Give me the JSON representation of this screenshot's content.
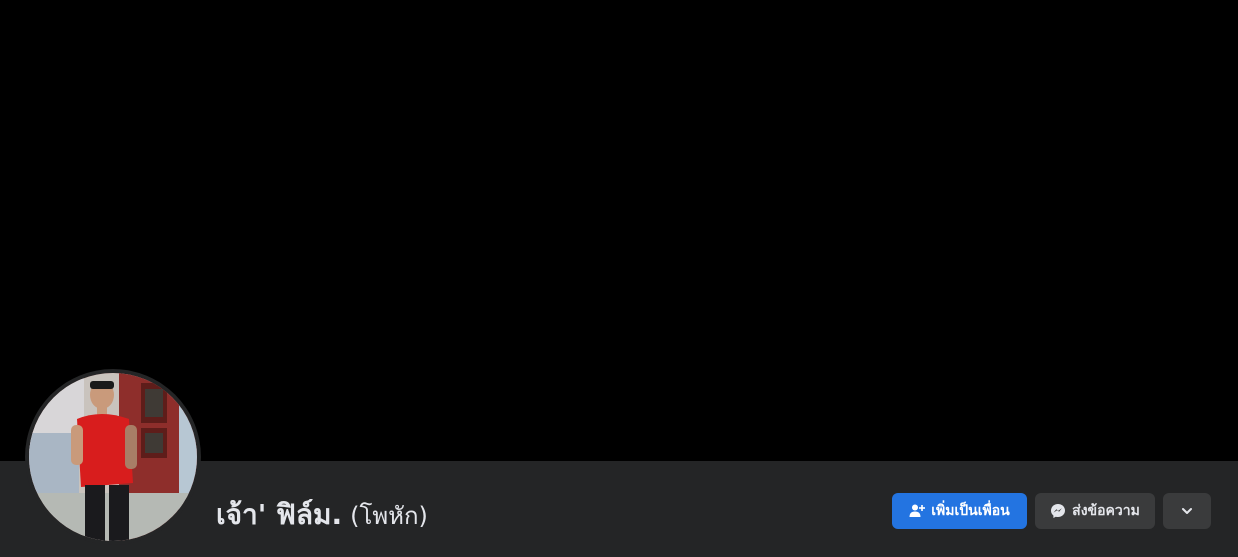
{
  "profile": {
    "name": "เจ้า' ฟิล์ม.",
    "alternate_name": "(โพหัก)"
  },
  "actions": {
    "add_friend_label": "เพิ่มเป็นเพื่อน",
    "message_label": "ส่งข้อความ"
  },
  "icons": {
    "add_friend": "add-friend-icon",
    "message": "messenger-icon",
    "more": "chevron-down-icon"
  },
  "colors": {
    "cover": "#000000",
    "bar": "#242526",
    "primary_button": "#2374e1",
    "secondary_button": "#3a3b3c",
    "text": "#e4e6eb"
  }
}
